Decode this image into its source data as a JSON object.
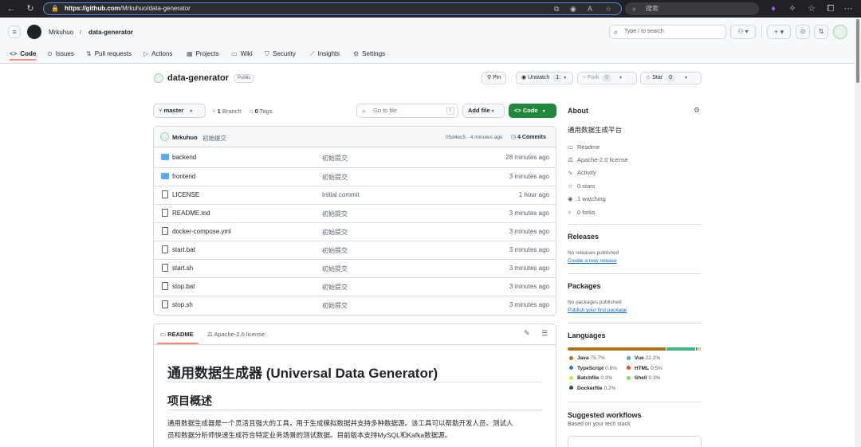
{
  "browser": {
    "url_host": "https://github.com",
    "url_path": "/Mrkuhuo/data-generator",
    "search_placeholder": "搜索"
  },
  "header": {
    "owner": "Mrkuhuo",
    "separator": "/",
    "repo": "data-generator",
    "search_text": "Type / to search"
  },
  "tabs": [
    {
      "label": "Code",
      "icon": "code-icon"
    },
    {
      "label": "Issues",
      "icon": "issue-icon"
    },
    {
      "label": "Pull requests",
      "icon": "pull-request-icon"
    },
    {
      "label": "Actions",
      "icon": "play-icon"
    },
    {
      "label": "Projects",
      "icon": "table-icon"
    },
    {
      "label": "Wiki",
      "icon": "book-icon"
    },
    {
      "label": "Security",
      "icon": "shield-icon"
    },
    {
      "label": "Insights",
      "icon": "graph-icon"
    },
    {
      "label": "Settings",
      "icon": "gear-icon"
    }
  ],
  "repo": {
    "name": "data-generator",
    "visibility": "Public",
    "pin_label": "Pin",
    "unwatch_label": "Unwatch",
    "watch_count": "1",
    "fork_label": "Fork",
    "fork_count": "0",
    "star_label": "Star",
    "star_count": "0"
  },
  "toolbar": {
    "branch": "master",
    "branches_count": "1",
    "branches_label": "Branch",
    "tags_count": "0",
    "tags_label": "Tags",
    "goto_placeholder": "Go to file",
    "goto_key": "t",
    "add_file": "Add file",
    "code_button": "Code"
  },
  "commit": {
    "author": "Mrkuhuo",
    "message": "初始提交",
    "meta": "05d4ec5 · 4 minutes ago",
    "commits": "4 Commits"
  },
  "files": [
    {
      "name": "backend",
      "type": "folder",
      "message": "初始提交",
      "time": "28 minutes ago"
    },
    {
      "name": "frontend",
      "type": "folder",
      "message": "初始提交",
      "time": "3 minutes ago"
    },
    {
      "name": "LICENSE",
      "type": "file",
      "message": "Initial commit",
      "time": "1 hour ago"
    },
    {
      "name": "README.md",
      "type": "file",
      "message": "初始提交",
      "time": "3 minutes ago"
    },
    {
      "name": "docker-compose.yml",
      "type": "file",
      "message": "初始提交",
      "time": "3 minutes ago"
    },
    {
      "name": "start.bat",
      "type": "file",
      "message": "初始提交",
      "time": "3 minutes ago"
    },
    {
      "name": "start.sh",
      "type": "file",
      "message": "初始提交",
      "time": "3 minutes ago"
    },
    {
      "name": "stop.bat",
      "type": "file",
      "message": "初始提交",
      "time": "3 minutes ago"
    },
    {
      "name": "stop.sh",
      "type": "file",
      "message": "初始提交",
      "time": "3 minutes ago"
    }
  ],
  "readme": {
    "tab_readme": "README",
    "tab_license": "Apache-2.0 license",
    "h1": "通用数据生成器 (Universal Data Generator)",
    "h2": "项目概述",
    "p1": "通用数据生成器是一个灵活且强大的工具，用于生成模拟数据并支持多种数据源。该工具可以帮助开发人员、测试人",
    "p2": "员和数据分析师快速生成符合特定业务场景的测试数据。目前版本支持MySQL和Kafka数据源。"
  },
  "about": {
    "title": "About",
    "description": "通用数据生成平台",
    "items": [
      {
        "icon": "book-icon",
        "label": "Readme"
      },
      {
        "icon": "law-icon",
        "label": "Apache-2.0 license"
      },
      {
        "icon": "pulse-icon",
        "label": "Activity"
      },
      {
        "icon": "star-icon",
        "label": "0 stars"
      },
      {
        "icon": "eye-icon",
        "label": "1 watching"
      },
      {
        "icon": "fork-icon",
        "label": "0 forks"
      }
    ]
  },
  "releases": {
    "title": "Releases",
    "empty": "No releases published",
    "link": "Create a new release"
  },
  "packages": {
    "title": "Packages",
    "empty": "No packages published",
    "link": "Publish your first package"
  },
  "languages": {
    "title": "Languages",
    "items": [
      {
        "name": "Java",
        "pct": "75.7%",
        "value": 75.7,
        "color": "#b07219"
      },
      {
        "name": "Vue",
        "pct": "22.2%",
        "value": 22.2,
        "color": "#41b883"
      },
      {
        "name": "TypeScript",
        "pct": "0.8%",
        "value": 0.8,
        "color": "#3178c6"
      },
      {
        "name": "HTML",
        "pct": "0.5%",
        "value": 0.5,
        "color": "#e34c26"
      },
      {
        "name": "Batchfile",
        "pct": "0.3%",
        "value": 0.3,
        "color": "#c1f12e"
      },
      {
        "name": "Shell",
        "pct": "0.3%",
        "value": 0.3,
        "color": "#89e051"
      },
      {
        "name": "Dockerfile",
        "pct": "0.2%",
        "value": 0.2,
        "color": "#384d54"
      }
    ]
  },
  "workflows": {
    "title": "Suggested workflows",
    "subtitle": "Based on your tech stack"
  }
}
